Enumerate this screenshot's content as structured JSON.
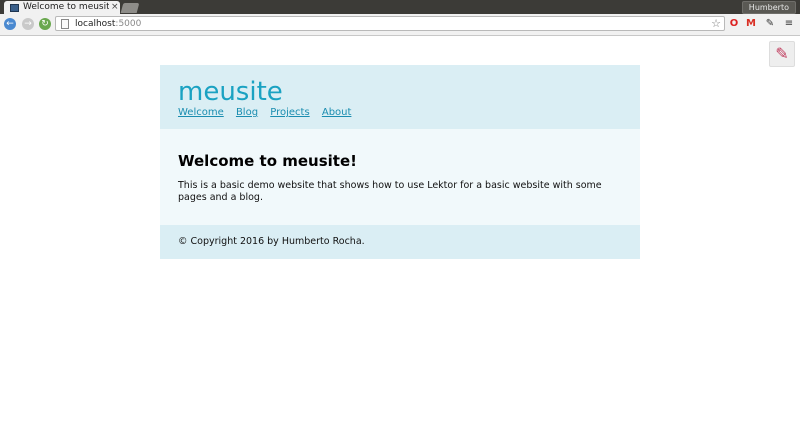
{
  "browser": {
    "tab_title": "Welcome to meusite",
    "tab_close": "×",
    "user_name": "Humberto",
    "url_host": "localhost",
    "url_port": ":5000",
    "star_icon": "☆",
    "back_glyph": "←",
    "forward_glyph": "→",
    "reload_glyph": "↻",
    "opera_glyph": "O",
    "gmail_glyph": "M",
    "picker_glyph": "✎",
    "menu_glyph": "≡",
    "edit_glyph": "✎",
    "icons": {
      "back": "back-arrow-icon",
      "forward": "forward-arrow-icon",
      "reload": "reload-icon",
      "bookmark": "star-icon",
      "edit": "pencil-icon"
    }
  },
  "site": {
    "title": "meusite",
    "nav": [
      "Welcome",
      "Blog",
      "Projects",
      "About"
    ],
    "heading": "Welcome to meusite!",
    "body_text": "This is a basic demo website that shows how to use Lektor for a basic website with some pages and a blog.",
    "footer": "© Copyright 2016 by Humberto Rocha.",
    "colors": {
      "header_bg": "#daeef4",
      "body_bg": "#f1f9fb",
      "title_color": "#1aa2c2",
      "link_color": "#1a8db0"
    }
  }
}
